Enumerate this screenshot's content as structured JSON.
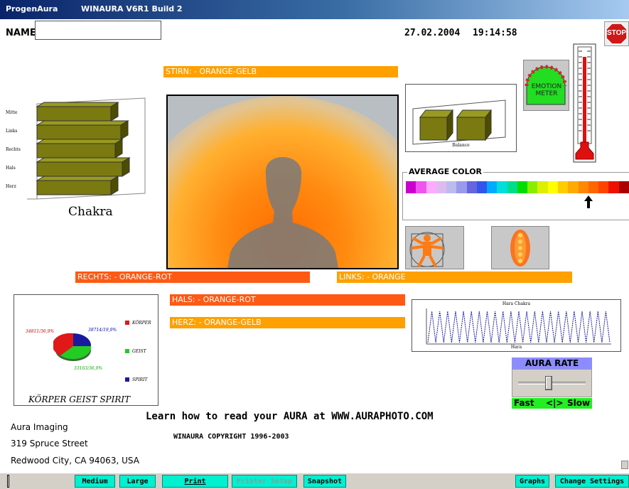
{
  "window": {
    "app_name": "ProgenAura",
    "version": "WINAURA V6R1 Build 2"
  },
  "header": {
    "name_label": "NAME",
    "name_value": "",
    "date": "27.02.2004",
    "time": "19:14:58",
    "stop_label": "STOP"
  },
  "color_labels": {
    "stirn": "STIRN: - ORANGE-GELB",
    "rechts": "RECHTS: - ORANGE-ROT",
    "links": "LINKS: - ORANGE",
    "hals": "HALS: - ORANGE-ROT",
    "herz": "HERZ: - ORANGE-GELB"
  },
  "chakra_chart": {
    "caption": "Chakra",
    "categories": [
      "Mitte",
      "Links",
      "Rechts",
      "Hals",
      "Herz"
    ]
  },
  "balance_chart": {
    "caption": "Balance"
  },
  "emotion_meter": {
    "label": "EMOTION METER"
  },
  "average_color": {
    "title": "AVERAGE COLOR",
    "palette": [
      "#cc00cc",
      "#ee55ee",
      "#ffaaff",
      "#ddbbee",
      "#bbbbee",
      "#9999ee",
      "#6666dd",
      "#3355ee",
      "#00aaff",
      "#00dddd",
      "#00dd88",
      "#00dd00",
      "#88ee00",
      "#ddee00",
      "#ffff00",
      "#ffcc00",
      "#ffaa00",
      "#ff8800",
      "#ff6600",
      "#ff4400",
      "#ee1100",
      "#aa0000"
    ],
    "indicator_index": 18
  },
  "pie_chart": {
    "caption": "KÖRPER GEIST SPIRIT",
    "label_red": "34811/36,9%",
    "label_blue": "38714/19,9%",
    "label_green": "33163/36,9%",
    "legend": [
      "KÖRPER",
      "GEIST",
      "SPIRIT"
    ]
  },
  "wave_chart": {
    "title": "Hara Chakra",
    "xlabel": "Hara"
  },
  "aura_rate": {
    "title": "AURA RATE",
    "fast": "Fast",
    "arrows": "<|>",
    "slow": "Slow",
    "slider_position": 0.45
  },
  "footer": {
    "learn_text": "Learn how to read your AURA at WWW.AURAPHOTO.COM",
    "copyright": "WINAURA  COPYRIGHT 1996-2003",
    "address_line1": "Aura Imaging",
    "address_line2": "319 Spruce Street",
    "address_line3": "Redwood City, CA  94063, USA"
  },
  "toolbar": {
    "medium": "Medium",
    "large": "Large",
    "print": "Print",
    "printer_setup": "Printer Setup",
    "snapshot": "Snapshot",
    "graphs": "Graphs",
    "change_settings": "Change Settings"
  },
  "colors": {
    "orange": "#ffa000",
    "red_orange": "#ff5a14",
    "aqua": "#00f0d0",
    "olive": "#7a7a10"
  }
}
